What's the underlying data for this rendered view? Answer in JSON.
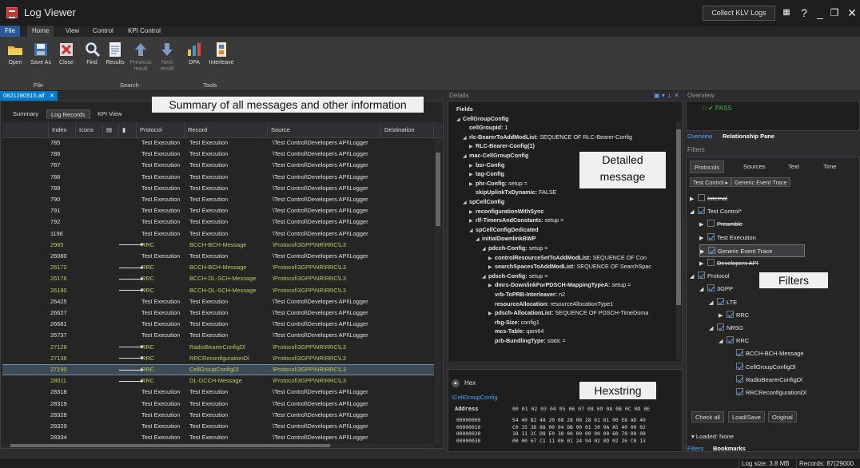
{
  "app": {
    "title": "Log Viewer",
    "collect_label": "Collect KLV Logs"
  },
  "ribbon_tabs": [
    "File",
    "Home",
    "View",
    "Control",
    "KPI Control"
  ],
  "ribbon": {
    "file_group": {
      "label": "File",
      "open": "Open",
      "save_as": "Save As",
      "close": "Close"
    },
    "search_group": {
      "label": "Search",
      "find": "Find",
      "results": "Results",
      "previous": "Previous result",
      "next": "Next result"
    },
    "tools_group": {
      "label": "Tools",
      "dpa": "DPA",
      "interleave": "Interleave"
    }
  },
  "left": {
    "doc_tab": "0821280515.alf",
    "banner": "Summary of all messages and other information",
    "subtabs": [
      "Summary",
      "Log Records",
      "KPI View"
    ],
    "columns": [
      "Index",
      "Icons",
      "",
      "",
      "Protocol",
      "Record",
      "Source",
      "Destination"
    ],
    "rows": [
      {
        "index": "785",
        "protocol": "Test Execution",
        "record": "Test Execution",
        "source": "\\Test Control\\Developers API\\Logger",
        "rrc": false
      },
      {
        "index": "786",
        "protocol": "Test Execution",
        "record": "Test Execution",
        "source": "\\Test Control\\Developers API\\Logger",
        "rrc": false
      },
      {
        "index": "787",
        "protocol": "Test Execution",
        "record": "Test Execution",
        "source": "\\Test Control\\Developers API\\Logger",
        "rrc": false
      },
      {
        "index": "788",
        "protocol": "Test Execution",
        "record": "Test Execution",
        "source": "\\Test Control\\Developers API\\Logger",
        "rrc": false
      },
      {
        "index": "789",
        "protocol": "Test Execution",
        "record": "Test Execution",
        "source": "\\Test Control\\Developers API\\Logger",
        "rrc": false
      },
      {
        "index": "790",
        "protocol": "Test Execution",
        "record": "Test Execution",
        "source": "\\Test Control\\Developers API\\Logger",
        "rrc": false
      },
      {
        "index": "791",
        "protocol": "Test Execution",
        "record": "Test Execution",
        "source": "\\Test Control\\Developers API\\Logger",
        "rrc": false
      },
      {
        "index": "792",
        "protocol": "Test Execution",
        "record": "Test Execution",
        "source": "\\Test Control\\Developers API\\Logger",
        "rrc": false
      },
      {
        "index": "1196",
        "protocol": "Test Execution",
        "record": "Test Execution",
        "source": "\\Test Control\\Developers API\\Logger",
        "rrc": false
      },
      {
        "index": "2965",
        "protocol": "RRC",
        "record": "BCCH-BCH-Message",
        "source": "\\Protocol\\3GPP\\NR\\RRC\\L3",
        "rrc": true
      },
      {
        "index": "26080",
        "protocol": "Test Execution",
        "record": "Test Execution",
        "source": "\\Test Control\\Developers API\\Logger",
        "rrc": false
      },
      {
        "index": "26172",
        "protocol": "RRC",
        "record": "BCCH-BCH-Message",
        "source": "\\Protocol\\3GPP\\NR\\RRC\\L3",
        "rrc": true
      },
      {
        "index": "26176",
        "protocol": "RRC",
        "record": "BCCH-DL-SCH-Message",
        "source": "\\Protocol\\3GPP\\NR\\RRC\\L3",
        "rrc": true
      },
      {
        "index": "26180",
        "protocol": "RRC",
        "record": "BCCH-DL-SCH-Message",
        "source": "\\Protocol\\3GPP\\NR\\RRC\\L3",
        "rrc": true
      },
      {
        "index": "26425",
        "protocol": "Test Execution",
        "record": "Test Execution",
        "source": "\\Test Control\\Developers API\\Logger",
        "rrc": false
      },
      {
        "index": "26627",
        "protocol": "Test Execution",
        "record": "Test Execution",
        "source": "\\Test Control\\Developers API\\Logger",
        "rrc": false
      },
      {
        "index": "26681",
        "protocol": "Test Execution",
        "record": "Test Execution",
        "source": "\\Test Control\\Developers API\\Logger",
        "rrc": false
      },
      {
        "index": "26737",
        "protocol": "Test Execution",
        "record": "Test Execution",
        "source": "\\Test Control\\Developers API\\Logger",
        "rrc": false
      },
      {
        "index": "27128",
        "protocol": "RRC",
        "record": "RadioBearerConfigDl",
        "source": "\\Protocol\\3GPP\\NR\\RRC\\L3",
        "rrc": true
      },
      {
        "index": "27136",
        "protocol": "RRC",
        "record": "RRCReconfigurationDl",
        "source": "\\Protocol\\3GPP\\NR\\RRC\\L3",
        "rrc": true
      },
      {
        "index": "27190",
        "protocol": "RRC",
        "record": "CellGroupConfigDl",
        "source": "\\Protocol\\3GPP\\NR\\RRC\\L3",
        "rrc": true,
        "selected": true
      },
      {
        "index": "28011",
        "protocol": "RRC",
        "record": "DL-DCCH-Message",
        "source": "\\Protocol\\3GPP\\NR\\RRC\\L3",
        "rrc": true
      },
      {
        "index": "28318",
        "protocol": "Test Execution",
        "record": "Test Execution",
        "source": "\\Test Control\\Developers API\\Logger",
        "rrc": false
      },
      {
        "index": "28319",
        "protocol": "Test Execution",
        "record": "Test Execution",
        "source": "\\Test Control\\Developers API\\Logger",
        "rrc": false
      },
      {
        "index": "28328",
        "protocol": "Test Execution",
        "record": "Test Execution",
        "source": "\\Test Control\\Developers API\\Logger",
        "rrc": false
      },
      {
        "index": "28329",
        "protocol": "Test Execution",
        "record": "Test Execution",
        "source": "\\Test Control\\Developers API\\Logger",
        "rrc": false
      },
      {
        "index": "28334",
        "protocol": "Test Execution",
        "record": "Test Execution",
        "source": "\\Test Control\\Developers API\\Logger",
        "rrc": false
      }
    ]
  },
  "details": {
    "title": "Details",
    "label": "Detailed message",
    "lines": [
      {
        "indent": 0,
        "tri": "",
        "html_key": "Fields",
        "val": ""
      },
      {
        "indent": 1,
        "tri": "◢",
        "html_key": "CellGroupConfig",
        "val": ""
      },
      {
        "indent": 2,
        "tri": "",
        "html_key": "cellGroupId:",
        "val": " 1"
      },
      {
        "indent": 2,
        "tri": "◢",
        "html_key": "rlc-BearerToAddModList:",
        "val": " SEQUENCE OF RLC-Bearer-Config"
      },
      {
        "indent": 3,
        "tri": "▶",
        "html_key": "RLC-Bearer-Config(1)",
        "val": ""
      },
      {
        "indent": 2,
        "tri": "◢",
        "html_key": "mac-CellGroupConfig",
        "val": ""
      },
      {
        "indent": 3,
        "tri": "▶",
        "html_key": "bsr-Config",
        "val": ""
      },
      {
        "indent": 3,
        "tri": "▶",
        "html_key": "tag-Config",
        "val": ""
      },
      {
        "indent": 3,
        "tri": "▶",
        "html_key": "phr-Config:",
        "val": " setup ="
      },
      {
        "indent": 3,
        "tri": "",
        "html_key": "skipUplinkTxDynamic:",
        "val": " FALSE"
      },
      {
        "indent": 2,
        "tri": "◢",
        "html_key": "spCellConfig",
        "val": ""
      },
      {
        "indent": 3,
        "tri": "▶",
        "html_key": "reconfigurationWithSync",
        "val": ""
      },
      {
        "indent": 3,
        "tri": "▶",
        "html_key": "rlf-TimersAndConstants:",
        "val": " setup ="
      },
      {
        "indent": 3,
        "tri": "◢",
        "html_key": "spCellConfigDedicated",
        "val": ""
      },
      {
        "indent": 4,
        "tri": "◢",
        "html_key": "initialDownlinkBWP",
        "val": ""
      },
      {
        "indent": 5,
        "tri": "◢",
        "html_key": "pdcch-Config:",
        "val": " setup ="
      },
      {
        "indent": 6,
        "tri": "▶",
        "html_key": "controlResourceSetToAddModList:",
        "val": " SEQUENCE OF Con"
      },
      {
        "indent": 6,
        "tri": "▶",
        "html_key": "searchSpacesToAddModList:",
        "val": " SEQUENCE OF SearchSpac"
      },
      {
        "indent": 5,
        "tri": "◢",
        "html_key": "pdsch-Config:",
        "val": " setup ="
      },
      {
        "indent": 6,
        "tri": "▶",
        "html_key": "dmrs-DownlinkForPDSCH-MappingTypeA:",
        "val": " setup ="
      },
      {
        "indent": 6,
        "tri": "",
        "html_key": "vrb-ToPRB-Interleaver:",
        "val": " n2"
      },
      {
        "indent": 6,
        "tri": "",
        "html_key": "resourceAllocation:",
        "val": " resourceAllocationType1"
      },
      {
        "indent": 6,
        "tri": "▶",
        "html_key": "pdsch-AllocationList:",
        "val": " SEQUENCE OF PDSCH-TimeDoma"
      },
      {
        "indent": 6,
        "tri": "",
        "html_key": "rbg-Size:",
        "val": " config1"
      },
      {
        "indent": 6,
        "tri": "",
        "html_key": "mcs-Table:",
        "val": " qam64"
      },
      {
        "indent": 6,
        "tri": "",
        "html_key": "prb-BundlingType:",
        "val": " static ="
      }
    ]
  },
  "hex": {
    "title": "Hex",
    "label": "Hexstring",
    "link": "\\CellGroupConfig",
    "address_header": "Address",
    "header_bytes": "00 01 02 03 04 05 06 07 08 09 0A 0B 0C 0D 0E",
    "rows": [
      {
        "addr": "00000000",
        "bytes": "54 40 B2 48 20 08 28 08 28 61 61 00 E8 AD 40"
      },
      {
        "addr": "00000010",
        "bytes": "C0 35 3D 88 00 04 DB 90 01 30 9A A5 40 00 02"
      },
      {
        "addr": "00000020",
        "bytes": "18 11 2C D8 E0 38 00 00 00 00 00 60 78 00 00"
      },
      {
        "addr": "00000030",
        "bytes": "00 00 67 C1 11 00 01 24 94 02 0D 02 26 C0 13"
      }
    ]
  },
  "overview": {
    "title": "Overview",
    "status": "PASS",
    "tabs": [
      "Overview",
      "Relationship Pane"
    ]
  },
  "filters": {
    "title": "Filters",
    "label": "Filters",
    "tabs": [
      "Protocols",
      "Sources",
      "Text",
      "Time"
    ],
    "chips": [
      "Test Control",
      "Generic Event Trace"
    ],
    "tree": [
      {
        "indent": 0,
        "tri": "▶",
        "check": "off",
        "label": "Internal",
        "strike": true
      },
      {
        "indent": 0,
        "tri": "◢",
        "check": "on",
        "label": "Test Control*",
        "strike": false
      },
      {
        "indent": 1,
        "tri": "▶",
        "check": "off",
        "label": "Preamble",
        "strike": true
      },
      {
        "indent": 1,
        "tri": "▶",
        "check": "on",
        "label": "Test Execution",
        "strike": false
      },
      {
        "indent": 1,
        "tri": "▶",
        "check": "on",
        "label": "Generic Event Trace",
        "strike": false,
        "selected": true
      },
      {
        "indent": 1,
        "tri": "▶",
        "check": "off",
        "label": "Developers API",
        "strike": true
      },
      {
        "indent": 0,
        "tri": "◢",
        "check": "on",
        "label": "Protocol",
        "strike": false
      },
      {
        "indent": 1,
        "tri": "◢",
        "check": "on",
        "label": "3GPP",
        "strike": false
      },
      {
        "indent": 2,
        "tri": "◢",
        "check": "on",
        "label": "LTE",
        "strike": false
      },
      {
        "indent": 3,
        "tri": "▶",
        "check": "on",
        "label": "RRC",
        "strike": false
      },
      {
        "indent": 2,
        "tri": "◢",
        "check": "on",
        "label": "NR5G",
        "strike": false
      },
      {
        "indent": 3,
        "tri": "◢",
        "check": "on",
        "label": "RRC",
        "strike": false
      },
      {
        "indent": 4,
        "tri": "",
        "check": "on",
        "label": "BCCH-BCH-Message",
        "strike": false
      },
      {
        "indent": 4,
        "tri": "",
        "check": "on",
        "label": "CellGroupConfigDl",
        "strike": false
      },
      {
        "indent": 4,
        "tri": "",
        "check": "on",
        "label": "RadioBearerConfigDl",
        "strike": false
      },
      {
        "indent": 4,
        "tri": "",
        "check": "on",
        "label": "RRCReconfigurationDl",
        "strike": false
      }
    ],
    "buttons": [
      "Check all",
      "Load/Save",
      "Original"
    ],
    "loaded": "Loaded: None",
    "bottom_tabs": [
      "Filters",
      "Bookmarks"
    ]
  },
  "status": {
    "log_size": "Log size: 3.8 MB",
    "records": "Records: 87(29000"
  }
}
